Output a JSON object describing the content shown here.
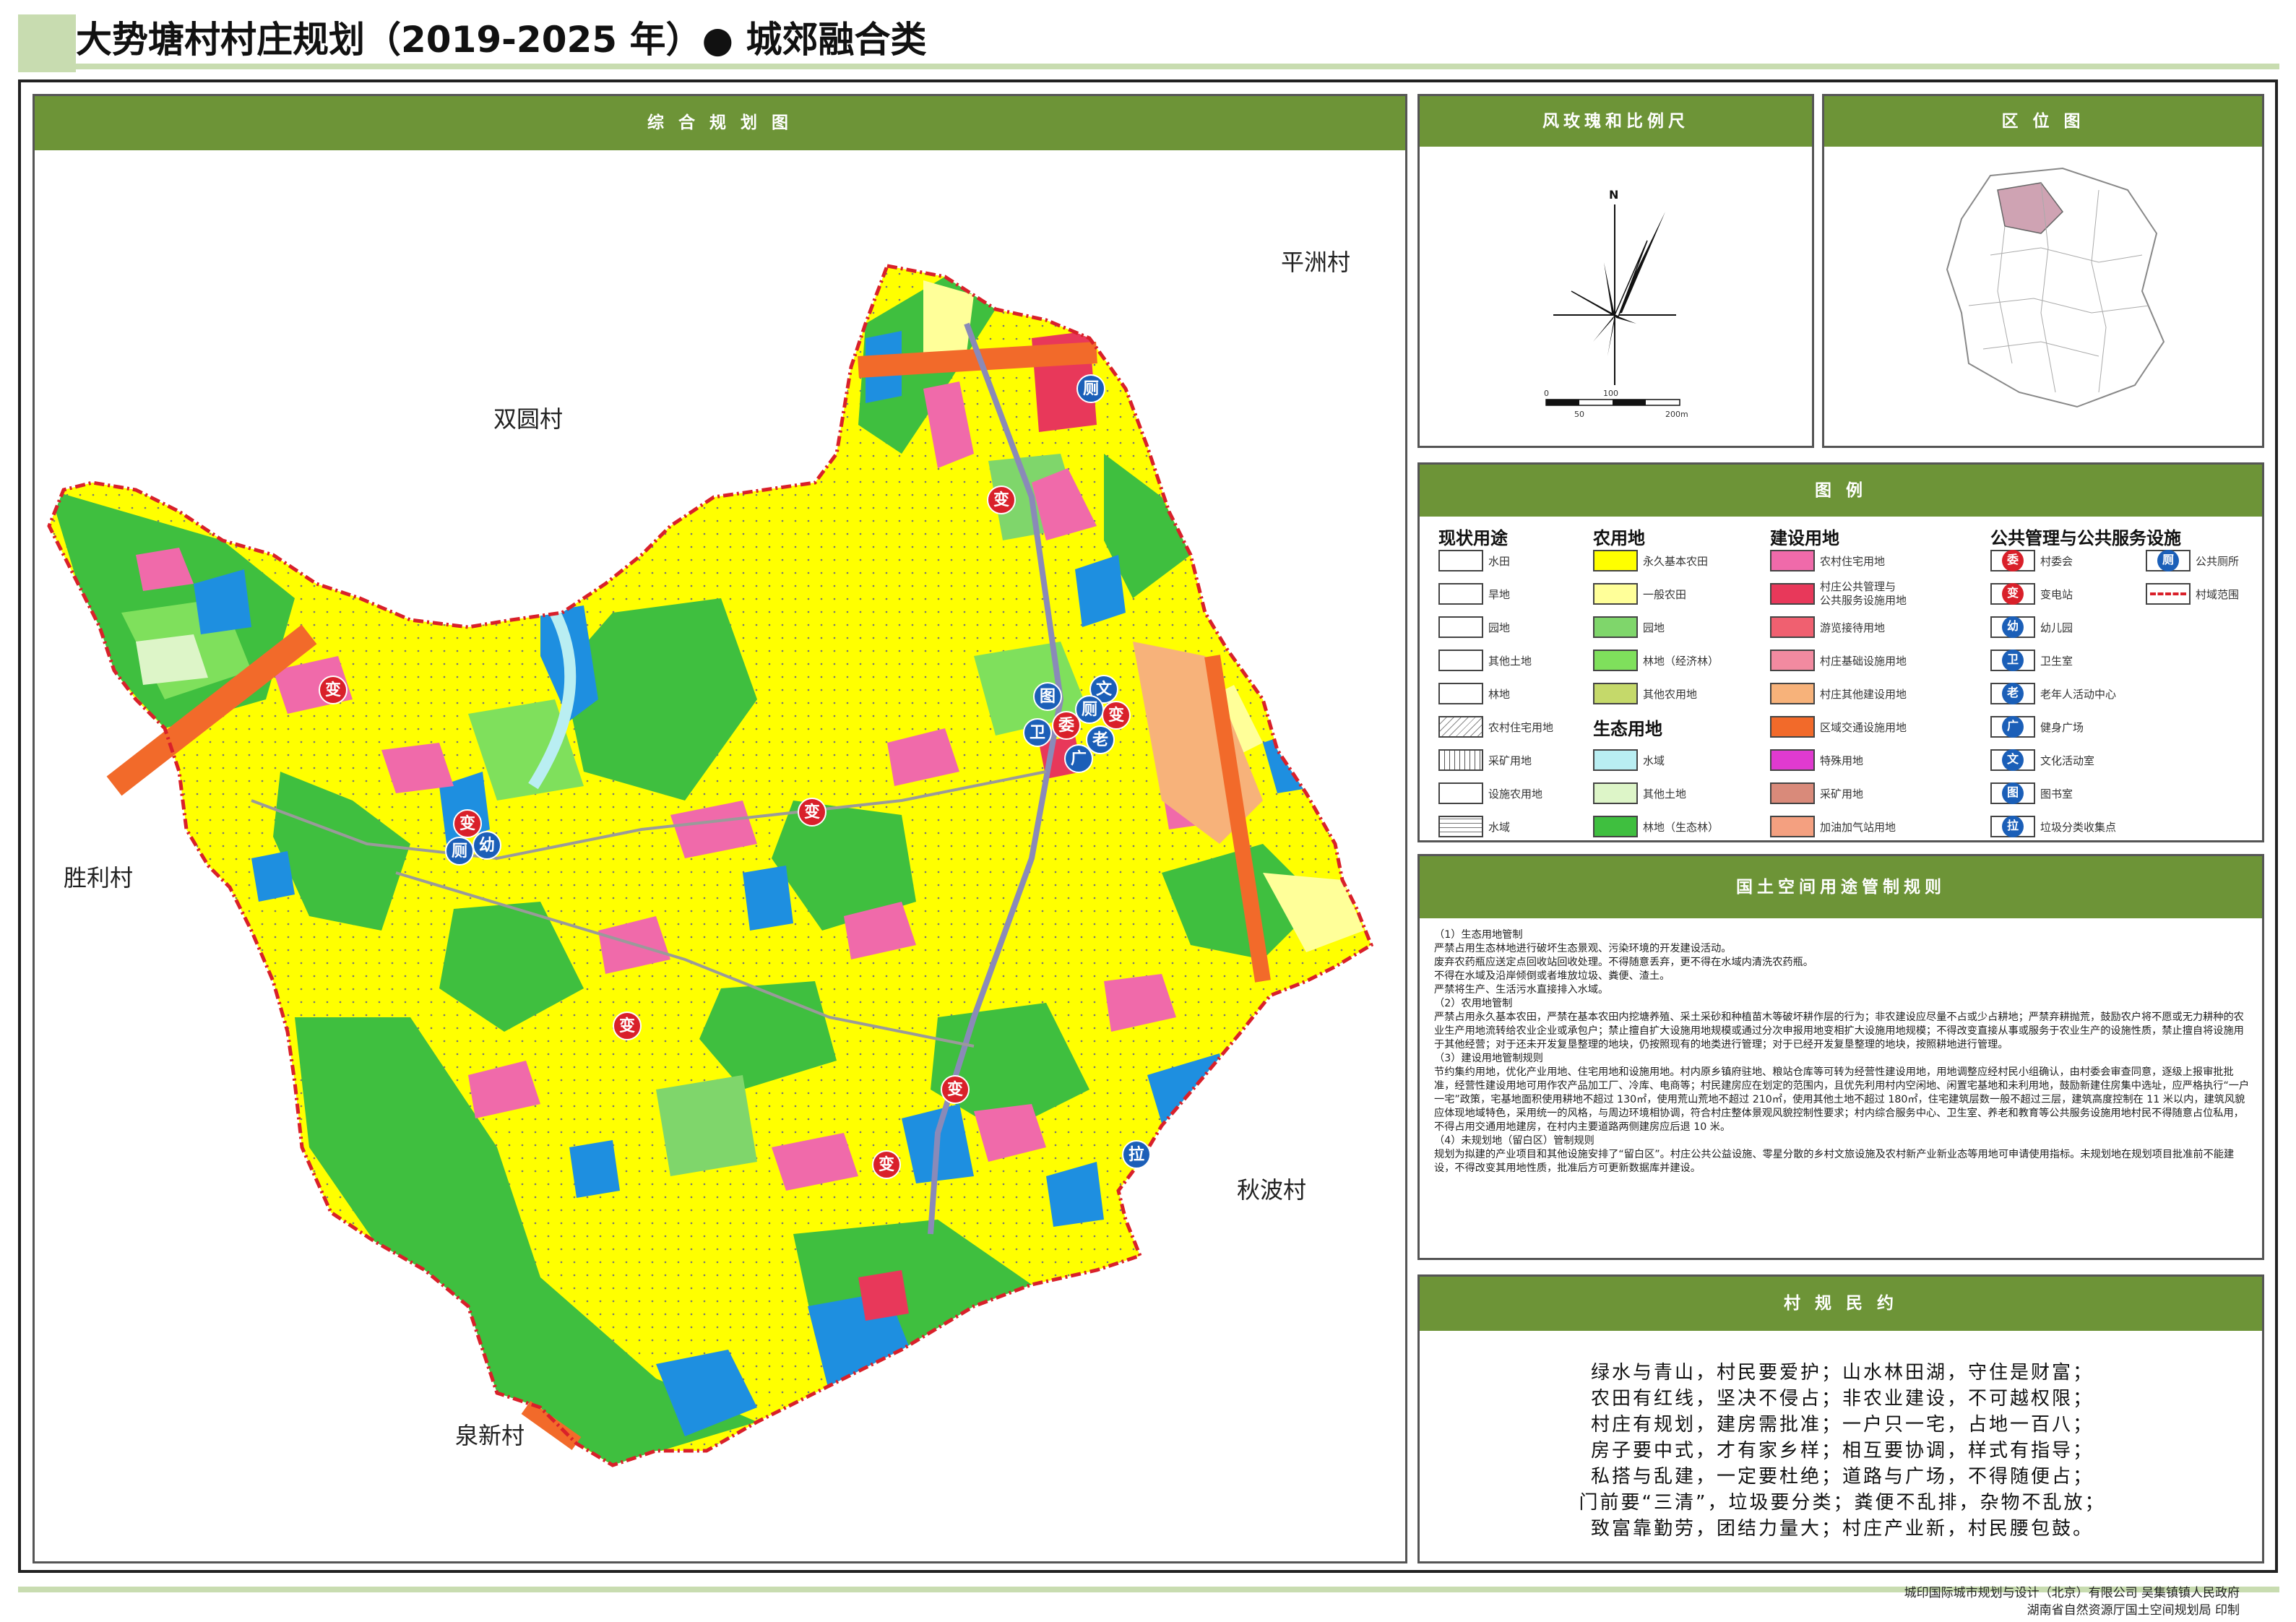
{
  "title": "大势塘村村庄规划（2019-2025 年）● 城郊融合类",
  "map_panel": {
    "heading": "综 合 规 划 图"
  },
  "neighbors": [
    "平洲村",
    "双圆村",
    "胜利村",
    "秋波村",
    "泉新村"
  ],
  "poi_markers": [
    {
      "label": "变",
      "color": "#d9202a"
    },
    {
      "label": "厕",
      "color": "#1b5fb8"
    },
    {
      "label": "变",
      "color": "#d9202a"
    },
    {
      "label": "图",
      "color": "#1b5fb8"
    },
    {
      "label": "文",
      "color": "#1b5fb8"
    },
    {
      "label": "厕",
      "color": "#1b5fb8"
    },
    {
      "label": "变",
      "color": "#d9202a"
    },
    {
      "label": "委",
      "color": "#d9202a"
    },
    {
      "label": "卫",
      "color": "#1b5fb8"
    },
    {
      "label": "老",
      "color": "#1b5fb8"
    },
    {
      "label": "广",
      "color": "#1b5fb8"
    },
    {
      "label": "变",
      "color": "#d9202a"
    },
    {
      "label": "厕",
      "color": "#1b5fb8"
    },
    {
      "label": "幼",
      "color": "#1b5fb8"
    },
    {
      "label": "变",
      "color": "#d9202a"
    },
    {
      "label": "变",
      "color": "#d9202a"
    },
    {
      "label": "变",
      "color": "#d9202a"
    },
    {
      "label": "变",
      "color": "#d9202a"
    },
    {
      "label": "拉",
      "color": "#1b5fb8"
    }
  ],
  "rose_panel": {
    "heading": "风玫瑰和比例尺",
    "north": "N",
    "scale_top": [
      "0",
      "100"
    ],
    "scale_bottom": [
      "50",
      "200m"
    ]
  },
  "location_panel": {
    "heading": "区 位 图"
  },
  "legend": {
    "heading": "图 例",
    "status_title": "现状用途",
    "status_items": [
      "水田",
      "旱地",
      "园地",
      "其他土地",
      "林地",
      "农村住宅用地",
      "采矿用地",
      "设施农用地",
      "水域"
    ],
    "agri_title": "农用地",
    "agri_items": [
      {
        "label": "永久基本农田",
        "color": "#ffff00"
      },
      {
        "label": "一般农田",
        "color": "#ffff99"
      },
      {
        "label": "园地",
        "color": "#7fd66b"
      },
      {
        "label": "林地（经济林）",
        "color": "#7fe05c"
      },
      {
        "label": "其他农用地",
        "color": "#c5d96a"
      }
    ],
    "eco_title": "生态用地",
    "eco_items": [
      {
        "label": "水域",
        "color": "#b9eef2"
      },
      {
        "label": "其他土地",
        "color": "#ddf5c8"
      },
      {
        "label": "林地（生态林）",
        "color": "#3fbf3f"
      }
    ],
    "build_title": "建设用地",
    "build_items": [
      {
        "label": "农村住宅用地",
        "color": "#f06aaa"
      },
      {
        "label": "村庄公共管理与\n公共服务设施用地",
        "color": "#e8385a"
      },
      {
        "label": "游览接待用地",
        "color": "#f06070"
      },
      {
        "label": "村庄基础设施用地",
        "color": "#f28aa0"
      },
      {
        "label": "村庄其他建设用地",
        "color": "#f7b27a"
      },
      {
        "label": "区域交通设施用地",
        "color": "#f26a2a"
      },
      {
        "label": "特殊用地",
        "color": "#e03ad0"
      },
      {
        "label": "采矿用地",
        "color": "#d98a7a"
      },
      {
        "label": "加油加气站用地",
        "color": "#f4a080"
      }
    ],
    "pub_title": "公共管理与公共服务设施",
    "pub_items": [
      {
        "icon": "委",
        "label": "村委会",
        "color": "#d9202a"
      },
      {
        "icon": "变",
        "label": "变电站",
        "color": "#d9202a"
      },
      {
        "icon": "幼",
        "label": "幼儿园",
        "color": "#1b5fb8"
      },
      {
        "icon": "卫",
        "label": "卫生室",
        "color": "#1b5fb8"
      },
      {
        "icon": "老",
        "label": "老年人活动中心",
        "color": "#1b5fb8"
      },
      {
        "icon": "广",
        "label": "健身广场",
        "color": "#1b5fb8"
      },
      {
        "icon": "文",
        "label": "文化活动室",
        "color": "#1b5fb8"
      },
      {
        "icon": "图",
        "label": "图书室",
        "color": "#1b5fb8"
      },
      {
        "icon": "拉",
        "label": "垃圾分类收集点",
        "color": "#1b5fb8"
      }
    ],
    "pub_items_right": [
      {
        "icon": "厕",
        "label": "公共厕所",
        "color": "#1b5fb8"
      },
      {
        "icon": "",
        "label": "村域范围",
        "color": "#d9202a"
      }
    ]
  },
  "rules": {
    "heading": "国土空间用途管制规则",
    "paragraphs": [
      "（1）生态用地管制",
      "严禁占用生态林地进行破坏生态景观、污染环境的开发建设活动。",
      "废弃农药瓶应送定点回收站回收处理。不得随意丢弃，更不得在水域内清洗农药瓶。",
      "不得在水域及沿岸倾倒或者堆放垃圾、粪便、渣土。",
      "严禁将生产、生活污水直接排入水域。",
      "（2）农用地管制",
      "严禁占用永久基本农田，严禁在基本农田内挖塘养殖、采土采砂和种植苗木等破坏耕作层的行为；非农建设应尽量不占或少占耕地；严禁弃耕抛荒，鼓励农户将不愿或无力耕种的农业生产用地流转给农业企业或承包户；禁止擅自扩大设施用地规模或通过分次申报用地变相扩大设施用地规模；不得改变直接从事或服务于农业生产的设施性质，禁止擅自将设施用于其他经营；对于还未开发复垦整理的地块，仍按照现有的地类进行管理；对于已经开发复垦整理的地块，按照耕地进行管理。",
      "（3）建设用地管制规则",
      "节约集约用地，优化产业用地、住宅用地和设施用地。村内原乡镇府驻地、粮站仓库等可转为经营性建设用地，用地调整应经村民小组确认，由村委会审查同意，逐级上报审批批准，经营性建设用地可用作农产品加工厂、冷库、电商等；村民建房应在划定的范围内，且优先利用村内空闲地、闲置宅基地和未利用地，鼓励新建住房集中选址，应严格执行“一户一宅”政策，宅基地面积使用耕地不超过 130㎡，使用荒山荒地不超过 210㎡，使用其他土地不超过 180㎡，住宅建筑层数一般不超过三层，建筑高度控制在 11 米以内，建筑风貌应体现地域特色，采用统一的风格，与周边环境相协调，符合村庄整体景观风貌控制性要求；村内综合服务中心、卫生室、养老和教育等公共服务设施用地村民不得随意占位私用，不得占用交通用地建房，在村内主要道路两侧建房应后退 10 米。",
      "（4）未规划地（留白区）管制规则",
      "规划为拟建的产业项目和其他设施安排了“留白区”。村庄公共公益设施、零星分散的乡村文旅设施及农村新产业新业态等用地可申请使用指标。未规划地在规划项目批准前不能建设，不得改变其用地性质，批准后方可更新数据库并建设。"
    ]
  },
  "pact": {
    "heading": "村 规 民 约",
    "lines": [
      "绿水与青山，村民要爱护；山水林田湖，守住是财富；",
      "农田有红线，坚决不侵占；非农业建设，不可越权限；",
      "村庄有规划，建房需批准；一户只一宅，占地一百八；",
      "房子要中式，才有家乡样；相互要协调，样式有指导；",
      "私搭与乱建，一定要杜绝；道路与广场，不得随便占；",
      "门前要“三清”，垃圾要分类；粪便不乱排，杂物不乱放；",
      "致富靠勤劳，团结力量大；村庄产业新，村民腰包鼓。"
    ]
  },
  "footer": [
    "城印国际城市规划与设计（北京）有限公司   吴集镇镇人民政府",
    "湖南省自然资源厅国土空间规划局 印制"
  ]
}
